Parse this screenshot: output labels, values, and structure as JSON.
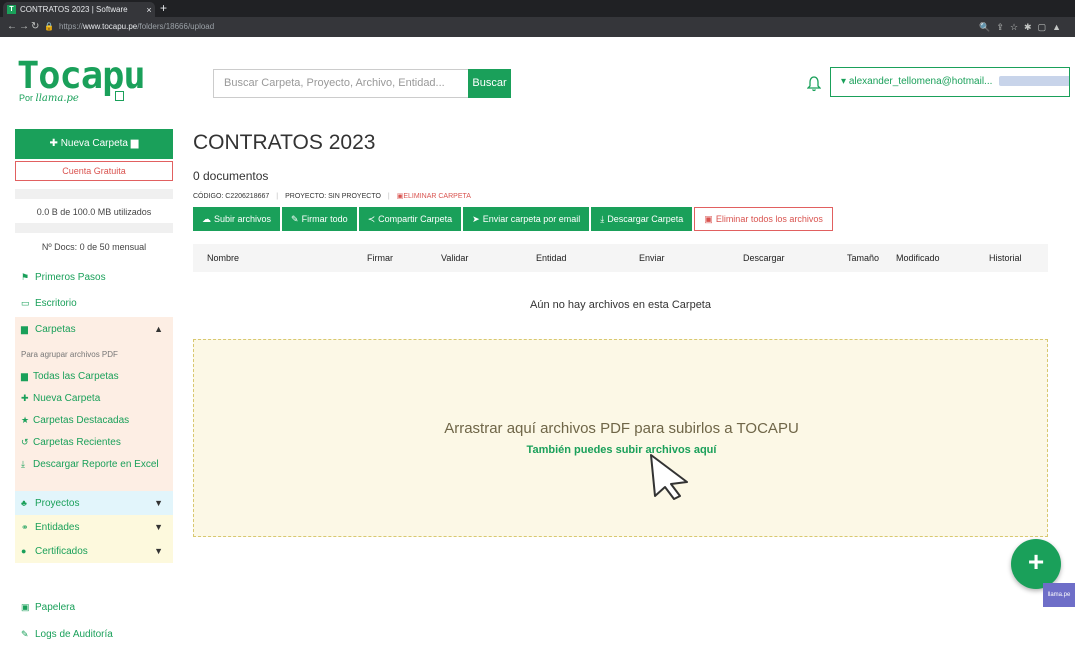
{
  "browser": {
    "tab_title": "CONTRATOS 2023 | Software",
    "tab_close": "×",
    "new_tab": "+",
    "url_prefix": "https://",
    "url_domain": "www.tocapu.pe",
    "url_path": "/folders/18666/upload"
  },
  "header": {
    "logo_text": "Tocapu",
    "logo_sub": "Por",
    "logo_sub_brand": "llama.pe",
    "search_placeholder": "Buscar Carpeta, Proyecto, Archivo, Entidad...",
    "search_button": "Buscar",
    "user_email": "alexander_tellomena@hotmail..."
  },
  "sidebar": {
    "new_folder": "Nueva Carpeta",
    "free_account": "Cuenta Gratuita",
    "storage_usage": "0.0 B de 100.0 MB utilizados",
    "docs_usage": "Nº Docs: 0 de 50 mensual",
    "first_steps": "Primeros Pasos",
    "desktop": "Escritorio",
    "folders": "Carpetas",
    "folders_hint": "Para agrupar archivos PDF",
    "all_folders": "Todas las Carpetas",
    "new_folder_link": "Nueva Carpeta",
    "starred_folders": "Carpetas Destacadas",
    "recent_folders": "Carpetas Recientes",
    "download_report": "Descargar Reporte en Excel",
    "projects": "Proyectos",
    "entities": "Entidades",
    "certificates": "Certificados",
    "trash": "Papelera",
    "audit_log": "Logs de Auditoría"
  },
  "main": {
    "title": "CONTRATOS 2023",
    "doc_count": "0 documentos",
    "code": "CÓDIGO: C2206218667",
    "project": "PROYECTO: SIN PROYECTO",
    "delete_folder": "ELIMINAR CARPETA",
    "toolbar": {
      "upload": "Subir archivos",
      "sign_all": "Firmar todo",
      "share": "Compartir Carpeta",
      "email": "Enviar carpeta por email",
      "download": "Descargar Carpeta",
      "delete_all": "Eliminar todos los archivos"
    },
    "columns": [
      "Nombre",
      "Firmar",
      "Validar",
      "Entidad",
      "Enviar",
      "Descargar",
      "Tamaño",
      "Modificado",
      "Historial"
    ],
    "empty_message": "Aún no hay archivos en esta Carpeta",
    "drop_text": "Arrastrar aquí archivos PDF para subirlos a TOCAPU",
    "drop_link": "También puedes subir archivos aquí"
  },
  "fab_label": "+",
  "watermark": "llama.pe",
  "colors": {
    "brand": "#1aa05a",
    "danger": "#d9534f",
    "dropzone": "#fcf8e6"
  }
}
